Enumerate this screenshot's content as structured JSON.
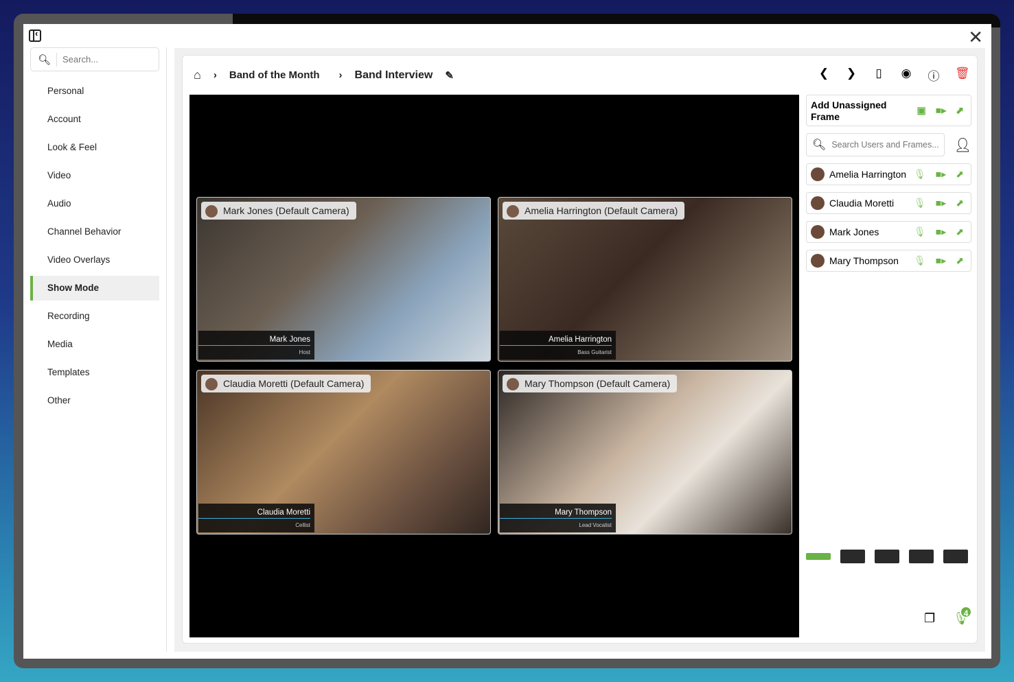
{
  "sidebar": {
    "search_placeholder": "Search...",
    "items": [
      "Personal",
      "Account",
      "Look & Feel",
      "Video",
      "Audio",
      "Channel Behavior",
      "Video Overlays",
      "Show Mode",
      "Recording",
      "Media",
      "Templates",
      "Other"
    ],
    "active": "Show Mode"
  },
  "breadcrumb": {
    "items": [
      "Band of the Month",
      "Band Interview"
    ]
  },
  "tiles": [
    {
      "label": "Mark Jones (Default Camera)",
      "name": "Mark Jones",
      "role": "Host",
      "bg": "linear-gradient(135deg,#3b3530,#6b5f52 40%,#8aa4bc 70%,#cfd8e0)"
    },
    {
      "label": "Amelia Harrington (Default Camera)",
      "name": "Amelia Harrington",
      "role": "Bass Guitarist",
      "bg": "linear-gradient(135deg,#5a4a3c,#3a2a22 45%,#7a6a5a 80%,#a09080)"
    },
    {
      "label": "Claudia Moretti (Default Camera)",
      "name": "Claudia Moretti",
      "role": "Cellist",
      "bg": "linear-gradient(135deg,#4a3526,#b08a60 45%,#6a5040 75%,#302620)"
    },
    {
      "label": "Mary Thompson (Default Camera)",
      "name": "Mary Thompson",
      "role": "Lead Vocalist",
      "bg": "linear-gradient(135deg,#2c2624,#c8b4a0 45%,#e8e2da 65%,#3a302a)"
    }
  ],
  "right_panel": {
    "add_frame": "Add Unassigned Frame",
    "search_placeholder": "Search Users and Frames...",
    "users": [
      "Amelia Harrington",
      "Claudia Moretti",
      "Mark Jones",
      "Mary Thompson"
    ],
    "mic_badge": "4"
  },
  "colors": {
    "accent": "#6ab344",
    "delete": "#e53935",
    "lower_third_line": "#3ab0e0"
  }
}
